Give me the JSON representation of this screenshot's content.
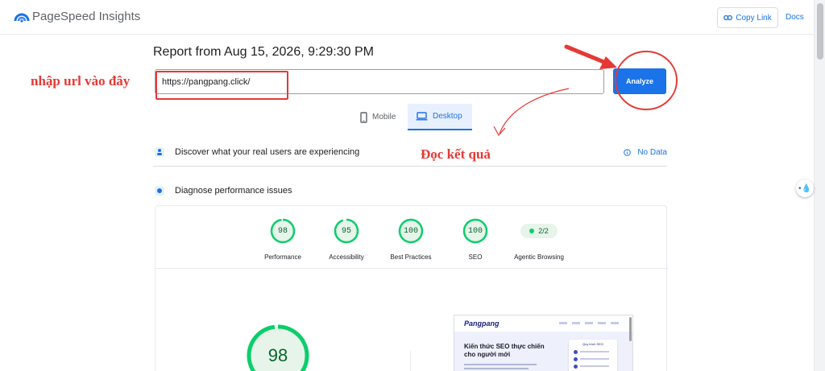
{
  "header": {
    "app_title": "PageSpeed Insights",
    "logo_icon": "pagespeed-logo-icon",
    "copy_link_label": "Copy Link",
    "docs_label": "Docs"
  },
  "report": {
    "title": "Report from Aug 15, 2026, 9:29:30 PM"
  },
  "search": {
    "value": "https://pangpang.click/",
    "analyze_label": "Analyze"
  },
  "device_tabs": {
    "mobile_label": "Mobile",
    "desktop_label": "Desktop",
    "selected": "Desktop"
  },
  "sections": {
    "discover_label": "Discover what your real users are experiencing",
    "no_data_label": "No Data",
    "diagnose_label": "Diagnose performance issues"
  },
  "scores": [
    {
      "label": "Performance",
      "value": "98",
      "fraction": 0.98
    },
    {
      "label": "Accessibility",
      "value": "95",
      "fraction": 0.95
    },
    {
      "label": "Best Practices",
      "value": "100",
      "fraction": 1.0
    },
    {
      "label": "SEO",
      "value": "100",
      "fraction": 1.0
    }
  ],
  "agentic": {
    "label": "Agentic Browsing",
    "value": "2/2"
  },
  "main_score": {
    "value": "98",
    "fraction": 0.98
  },
  "preview": {
    "logo": "Pangpang",
    "heading": "Kiến thức SEO thực chiến cho người mới",
    "panel_title": "Quy trình SEO"
  },
  "annotations": {
    "url_note": "nhập url vào đây",
    "result_note": "Đọc kết quả"
  },
  "colors": {
    "accent": "#1a73e8",
    "pass_green": "#0cce6b",
    "annotation_red": "#e53935"
  }
}
